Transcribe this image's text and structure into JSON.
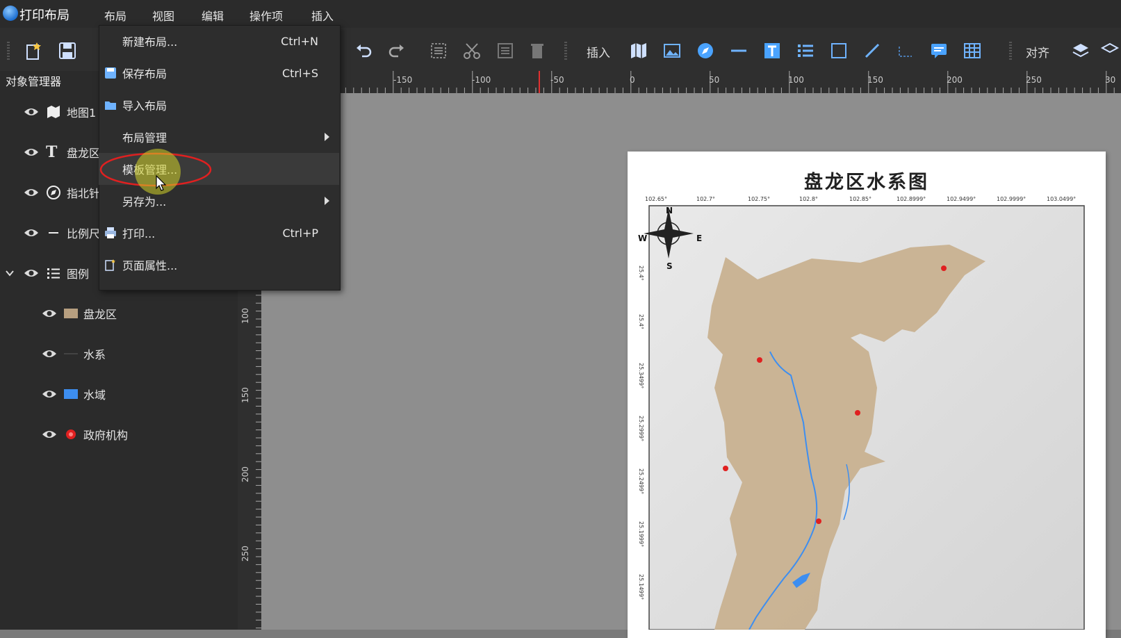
{
  "app": {
    "title": "打印布局"
  },
  "menubar": {
    "items": [
      "布局",
      "视图",
      "编辑",
      "操作项",
      "插入"
    ]
  },
  "toolbar": {
    "insert_label": "插入",
    "align_label": "对齐"
  },
  "panel": {
    "title": "对象管理器",
    "items": [
      {
        "label": "地图1",
        "icon": "map-icon"
      },
      {
        "label": "盘龙区",
        "icon": "text-icon"
      },
      {
        "label": "指北针",
        "icon": "compass-icon"
      },
      {
        "label": "比例尺",
        "icon": "scalebar-icon"
      },
      {
        "label": "图例",
        "icon": "legend-icon"
      }
    ],
    "legend_children": [
      {
        "label": "盘龙区",
        "swatch": "#b79f80"
      },
      {
        "label": "水系",
        "swatch": "#444444"
      },
      {
        "label": "水域",
        "swatch": "#3d8ef0"
      },
      {
        "label": "政府机构",
        "swatch": "#e02020"
      }
    ]
  },
  "ruler_top": [
    "-150",
    "-100",
    "-50",
    "0",
    "50",
    "100",
    "150",
    "200",
    "250",
    "30"
  ],
  "ruler_left": [
    "100",
    "150",
    "200",
    "250"
  ],
  "dropdown": {
    "items": [
      {
        "label": "新建布局...",
        "shortcut": "Ctrl+N"
      },
      {
        "label": "保存布局",
        "shortcut": "Ctrl+S"
      },
      {
        "label": "导入布局",
        "shortcut": ""
      },
      {
        "label": "布局管理",
        "shortcut": ""
      },
      {
        "label": "模板管理...",
        "shortcut": ""
      },
      {
        "label": "另存为...",
        "shortcut": ""
      },
      {
        "label": "打印...",
        "shortcut": "Ctrl+P"
      },
      {
        "label": "页面属性...",
        "shortcut": ""
      }
    ]
  },
  "map": {
    "title": "盘龙区水系图",
    "compass": {
      "n": "N",
      "s": "S",
      "e": "E",
      "w": "W"
    },
    "top_ticks": [
      "102.65°",
      "102.7°",
      "102.75°",
      "102.8°",
      "102.85°",
      "102.8999°",
      "102.9499°",
      "102.9999°",
      "103.0499°"
    ],
    "left_ticks": [
      "25.4°",
      "25.4°",
      "25.3499°",
      "25.2999°",
      "25.2499°",
      "25.1999°",
      "25.1499°"
    ]
  },
  "colors": {
    "highlight_circle": "#e02020",
    "accent": "#3d8ef0",
    "district_fill": "#c8b08e"
  }
}
